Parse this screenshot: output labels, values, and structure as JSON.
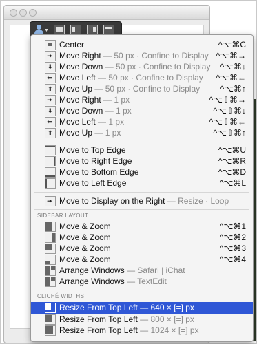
{
  "toolbar": {
    "buttons": [
      "user-menu",
      "layout-1",
      "layout-2",
      "layout-3",
      "layout-4"
    ]
  },
  "group1": [
    {
      "label": "Center",
      "sub": "",
      "shortcut": "^⌥⌘C",
      "icon": "center-icon"
    },
    {
      "label": "Move Right",
      "sub": "— 50 px · Confine to Display",
      "shortcut": "^⌥⌘→",
      "icon": "arrow-right-icon"
    },
    {
      "label": "Move Down",
      "sub": "— 50 px · Confine to Display",
      "shortcut": "^⌥⌘↓",
      "icon": "arrow-down-icon"
    },
    {
      "label": "Move Left",
      "sub": "— 50 px · Confine to Display",
      "shortcut": "^⌥⌘←",
      "icon": "arrow-left-icon"
    },
    {
      "label": "Move Up",
      "sub": "— 50 px · Confine to Display",
      "shortcut": "^⌥⌘↑",
      "icon": "arrow-up-icon"
    },
    {
      "label": "Move Right",
      "sub": "— 1 px",
      "shortcut": "^⌥⇧⌘→",
      "icon": "arrow-right-icon"
    },
    {
      "label": "Move Down",
      "sub": "— 1 px",
      "shortcut": "^⌥⇧⌘↓",
      "icon": "arrow-down-icon"
    },
    {
      "label": "Move Left",
      "sub": "— 1 px",
      "shortcut": "^⌥⇧⌘←",
      "icon": "arrow-left-icon"
    },
    {
      "label": "Move Up",
      "sub": "— 1 px",
      "shortcut": "^⌥⇧⌘↑",
      "icon": "arrow-up-icon"
    }
  ],
  "group2": [
    {
      "label": "Move to Top Edge",
      "shortcut": "^⌥⌘U",
      "icon": "top-edge-icon"
    },
    {
      "label": "Move to Right Edge",
      "shortcut": "^⌥⌘R",
      "icon": "right-edge-icon"
    },
    {
      "label": "Move to Bottom Edge",
      "shortcut": "^⌥⌘D",
      "icon": "bottom-edge-icon"
    },
    {
      "label": "Move to Left Edge",
      "shortcut": "^⌥⌘L",
      "icon": "left-edge-icon"
    }
  ],
  "group3": [
    {
      "label": "Move to Display on the Right",
      "sub": "— Resize · Loop",
      "shortcut": "",
      "icon": "display-right-icon"
    }
  ],
  "sidebar_layout": {
    "title": "SIDEBAR LAYOUT",
    "items": [
      {
        "label": "Move & Zoom",
        "sub": "",
        "shortcut": "^⌥⌘1",
        "icon": "zoom-1-icon"
      },
      {
        "label": "Move & Zoom",
        "sub": "",
        "shortcut": "^⌥⌘2",
        "icon": "zoom-2-icon"
      },
      {
        "label": "Move & Zoom",
        "sub": "",
        "shortcut": "^⌥⌘3",
        "icon": "zoom-3-icon"
      },
      {
        "label": "Move & Zoom",
        "sub": "",
        "shortcut": "^⌥⌘4",
        "icon": "zoom-4-icon"
      },
      {
        "label": "Arrange Windows",
        "sub": "— Safari | iChat",
        "shortcut": "",
        "icon": "arrange-icon"
      },
      {
        "label": "Arrange Windows",
        "sub": "— TextEdit",
        "shortcut": "",
        "icon": "arrange-icon"
      }
    ]
  },
  "cliche_widths": {
    "title": "CLICHÉ WIDTHS",
    "items": [
      {
        "label": "Resize From Top Left",
        "sub": "— 640 × [=] px",
        "shortcut": "",
        "icon": "resize-icon",
        "selected": true
      },
      {
        "label": "Resize From Top Left",
        "sub": "— 800 × [=] px",
        "shortcut": "",
        "icon": "resize-icon",
        "selected": false
      },
      {
        "label": "Resize From Top Left",
        "sub": "— 1024 × [=] px",
        "shortcut": "",
        "icon": "resize-icon",
        "selected": false
      }
    ]
  }
}
